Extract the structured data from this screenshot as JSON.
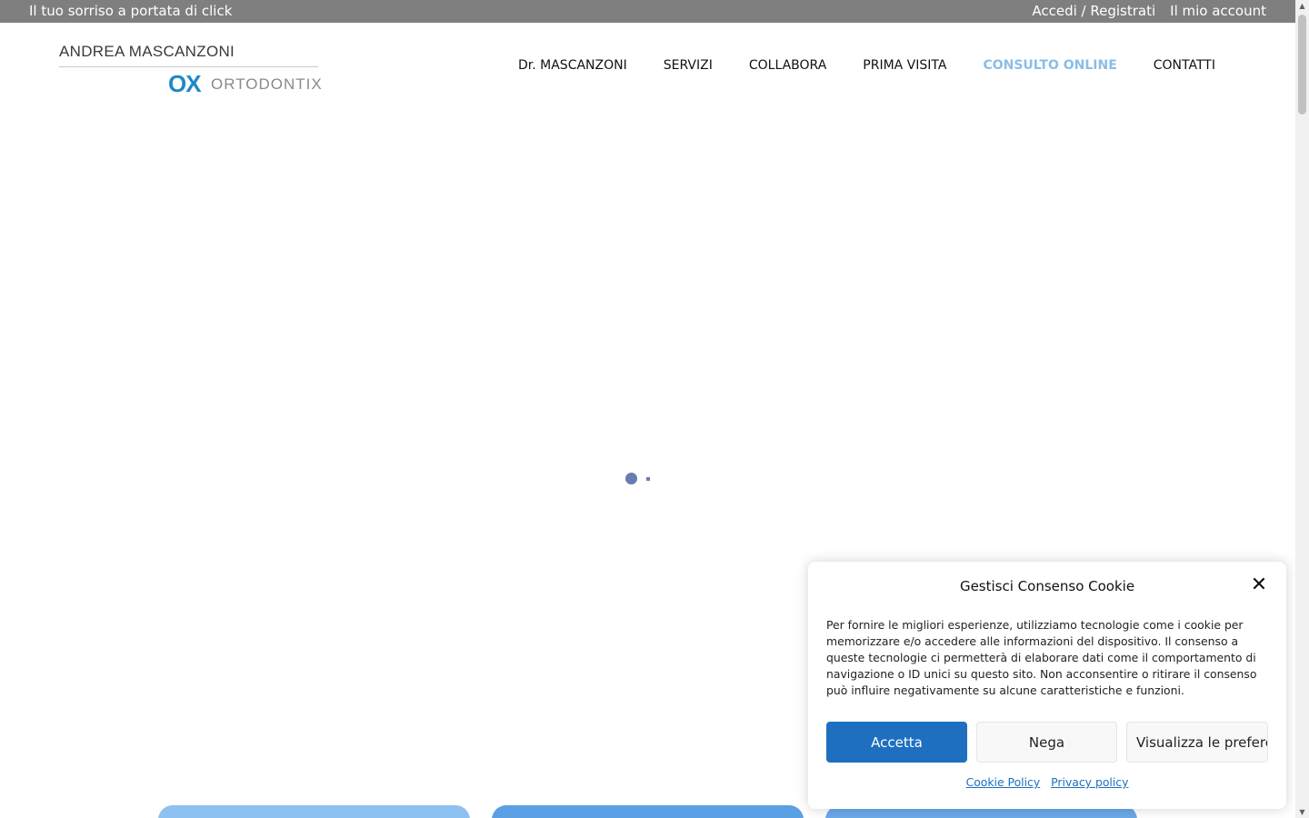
{
  "topbar": {
    "tagline": "Il tuo sorriso a portata di click",
    "login": "Accedi / Registrati",
    "account": "Il mio account"
  },
  "logo": {
    "name": "ANDREA MASCANZONI",
    "mark": "OX",
    "brand": "ORTODONTIX"
  },
  "nav": {
    "items": [
      {
        "label": "Dr. MASCANZONI"
      },
      {
        "label": "SERVIZI"
      },
      {
        "label": "COLLABORA"
      },
      {
        "label": "PRIMA VISITA"
      },
      {
        "label": "CONSULTO ONLINE"
      },
      {
        "label": "CONTATTI"
      }
    ],
    "active_color": "#8bbde8"
  },
  "cookie": {
    "title": "Gestisci Consenso Cookie",
    "close_icon": "close-icon",
    "body": "Per fornire le migliori esperienze, utilizziamo tecnologie come i cookie per memorizzare e/o accedere alle informazioni del dispositivo. Il consenso a queste tecnologie ci permetterà di elaborare dati come il comportamento di navigazione o ID unici su questo sito. Non acconsentire o ritirare il consenso può influire negativamente su alcune caratteristiche e funzioni.",
    "accept": "Accetta",
    "deny": "Nega",
    "preferences": "Visualizza le preferenze",
    "cookie_policy": "Cookie Policy",
    "privacy_policy": "Privacy policy",
    "primary_color": "#1e6fc0"
  }
}
